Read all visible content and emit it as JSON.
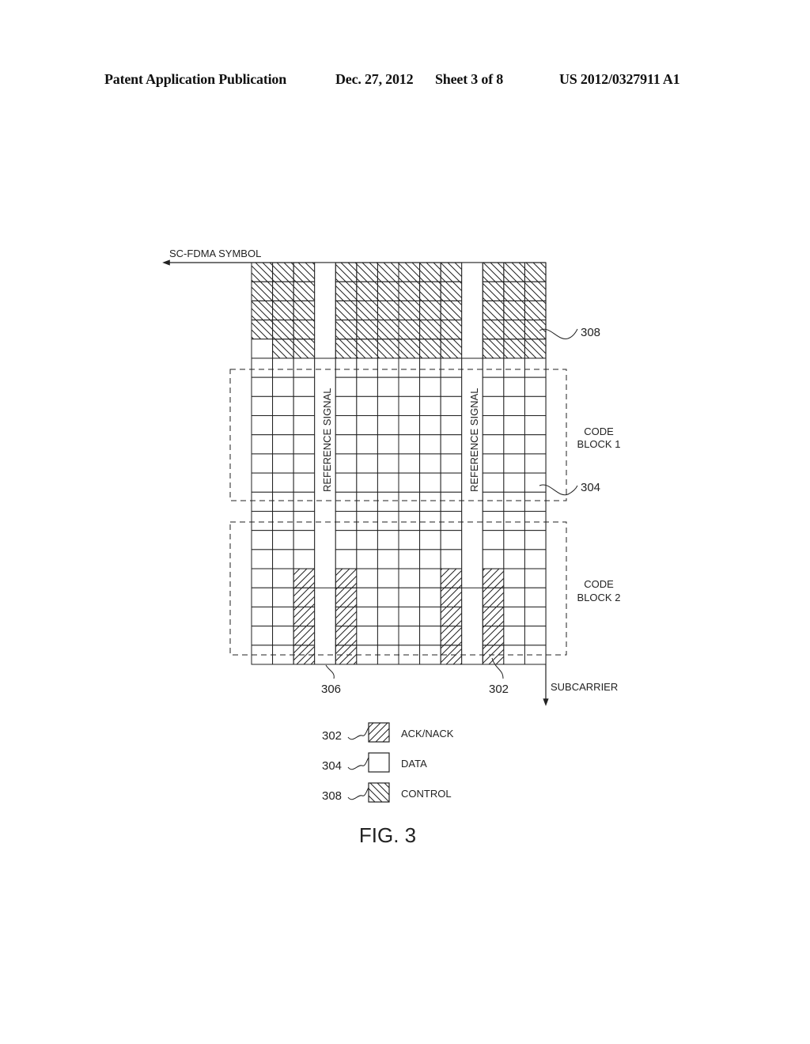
{
  "header": {
    "publication": "Patent Application Publication",
    "date": "Dec. 27, 2012",
    "sheet": "Sheet 3 of 8",
    "number": "US 2012/0327911 A1"
  },
  "figure": {
    "axis_x_label": "SC-FDMA SYMBOL",
    "axis_y_label": "SUBCARRIER",
    "reference_signal_label": "REFERENCE SIGNAL",
    "code_block_1": [
      "CODE",
      "BLOCK 1"
    ],
    "code_block_2": [
      "CODE",
      "BLOCK 2"
    ],
    "refs": {
      "control": "308",
      "data": "304",
      "rs": "306",
      "ack": "302"
    },
    "grid": {
      "columns": 14,
      "rows": 21,
      "reference_signal_columns": [
        3,
        10
      ],
      "control_rows": 5,
      "control_blank_cells": [
        [
          4,
          0
        ]
      ],
      "ack_nack_columns": [
        2,
        4,
        9,
        11
      ],
      "ack_nack_rows": [
        16,
        17,
        18,
        19,
        20
      ]
    },
    "caption": "FIG. 3"
  },
  "legend": [
    {
      "ref": "302",
      "label": "ACK/NACK",
      "pattern": "ack"
    },
    {
      "ref": "304",
      "label": "DATA",
      "pattern": "data"
    },
    {
      "ref": "308",
      "label": "CONTROL",
      "pattern": "control"
    }
  ]
}
